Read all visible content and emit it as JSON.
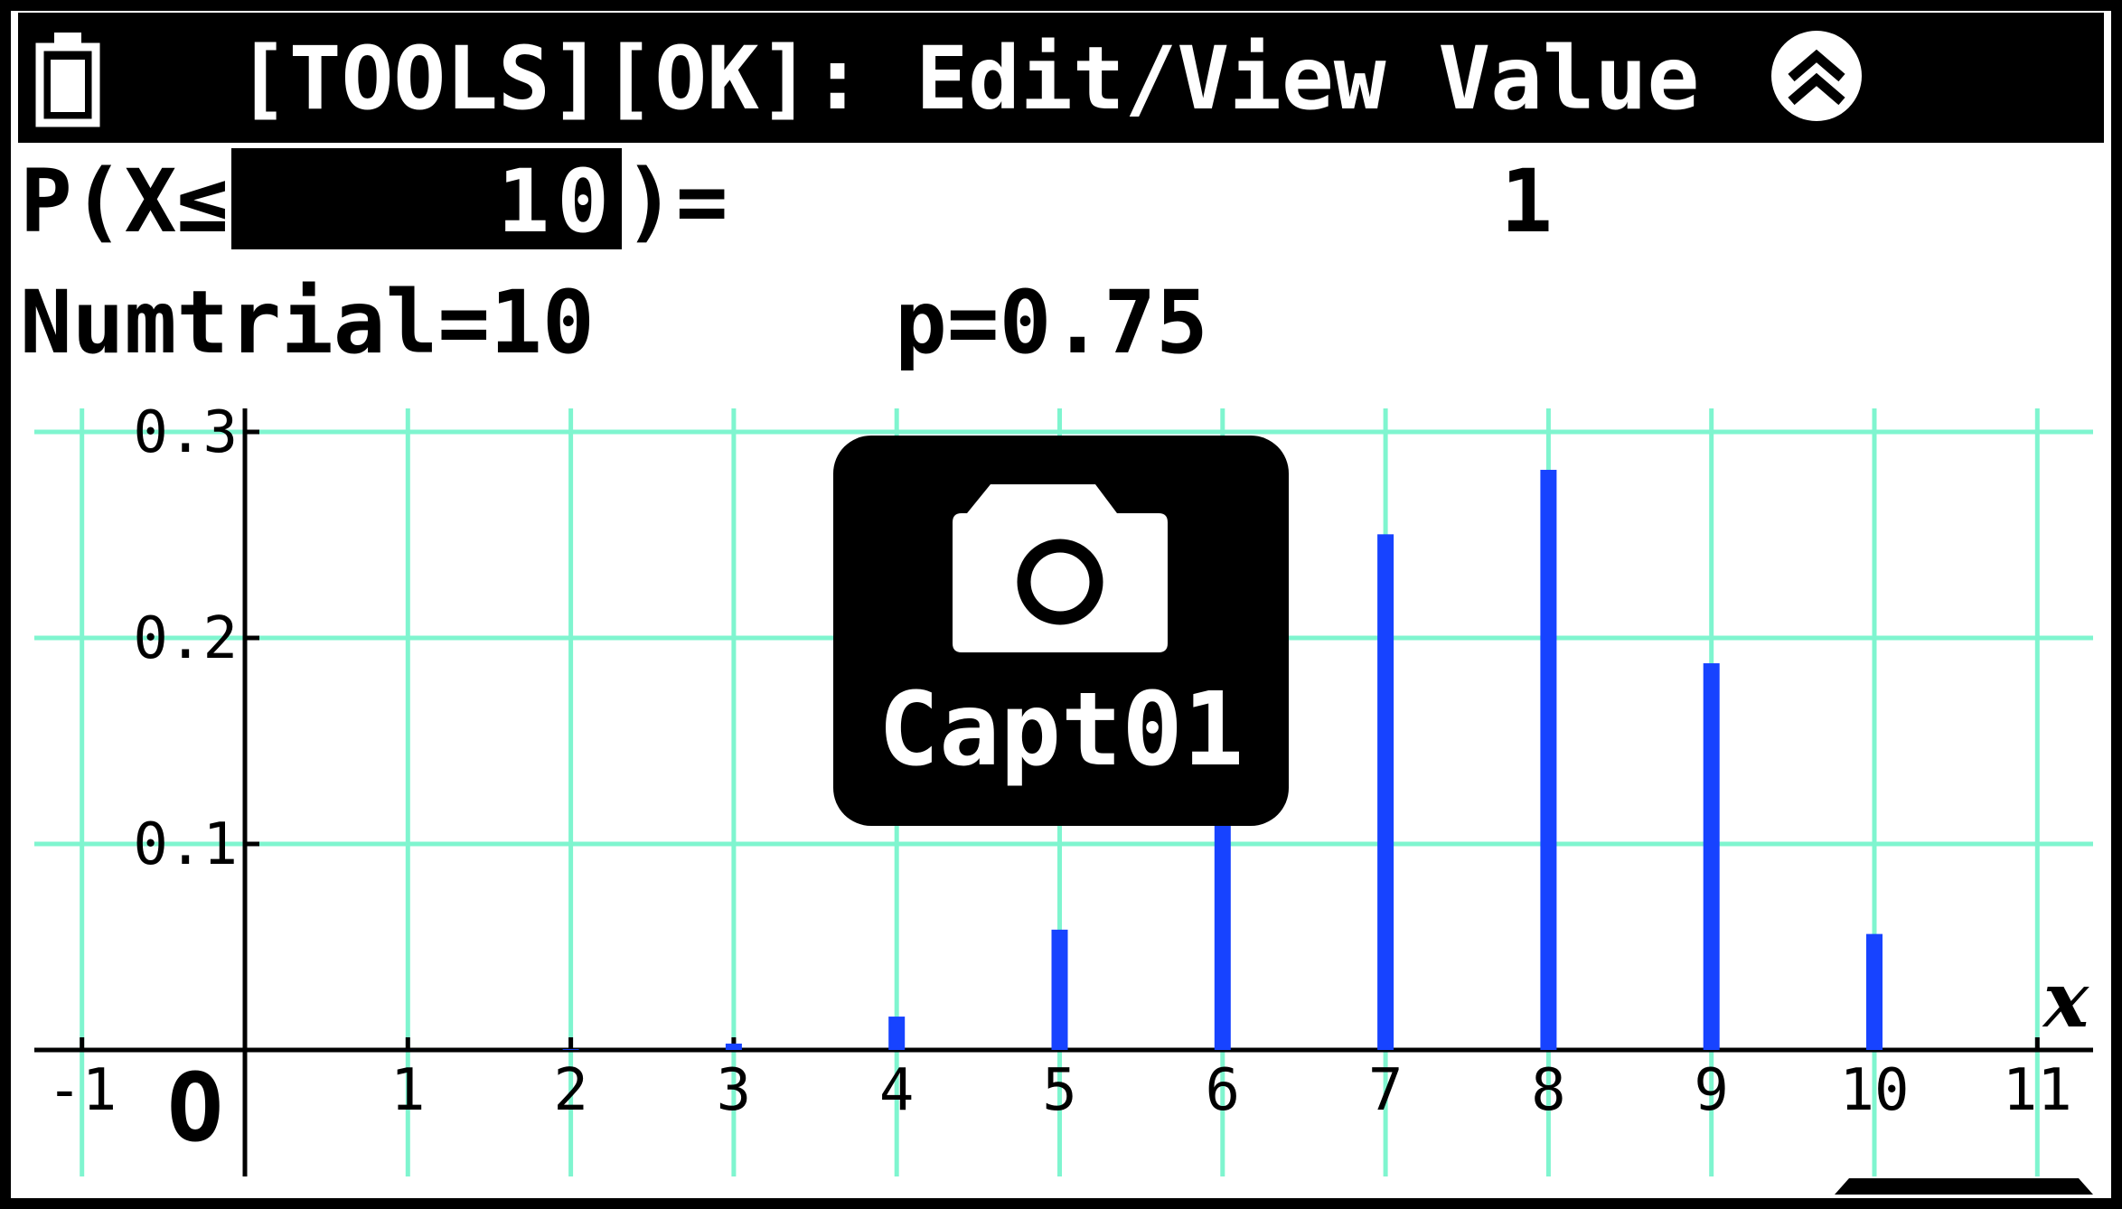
{
  "header": {
    "title": "[TOOLS][OK]: Edit/View Value",
    "battery_icon": "battery-icon",
    "collapse_icon": "double-chevron-up-icon"
  },
  "probability_row": {
    "label_prefix": "P(X≤",
    "input_value": "10",
    "label_suffix": ")=",
    "result": "1"
  },
  "params_row": {
    "numtrial": "Numtrial=10",
    "p": "p=0.75"
  },
  "popup": {
    "icon": "camera-icon",
    "label": "Capt01"
  },
  "colors": {
    "grid": "#7ff5cf",
    "bar": "#1743ff",
    "title_bg": "#000000",
    "popup_bg": "#000000"
  },
  "chart_data": {
    "type": "bar",
    "x_axis_label": "x",
    "origin_label": "O",
    "xlim": [
      -1.3,
      11.3
    ],
    "ylim": [
      0,
      0.3
    ],
    "x_ticks": [
      -1,
      1,
      2,
      3,
      4,
      5,
      6,
      7,
      8,
      9,
      10,
      11
    ],
    "y_ticks": [
      0.1,
      0.2,
      0.3
    ],
    "grid": true,
    "x": [
      0,
      1,
      2,
      3,
      4,
      5,
      6,
      7,
      8,
      9,
      10
    ],
    "values": [
      1e-06,
      3e-05,
      0.0004,
      0.0031,
      0.0162,
      0.0584,
      0.146,
      0.2503,
      0.2816,
      0.1877,
      0.0563
    ]
  }
}
